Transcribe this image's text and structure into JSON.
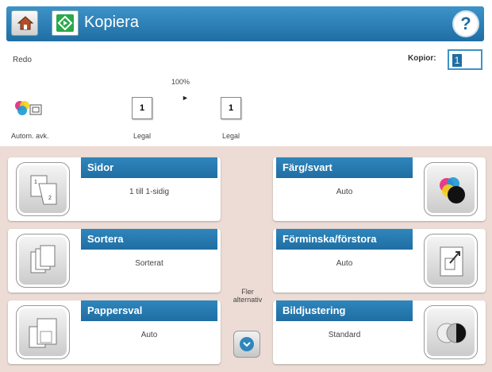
{
  "header": {
    "title": "Kopiera",
    "help": "?"
  },
  "status": {
    "ready_text": "Redo",
    "copies_label": "Kopior:",
    "copies_value": "1",
    "scale": "100%",
    "source_copies": "1",
    "source_paper": "Legal",
    "dest_copies": "1",
    "dest_paper": "Legal",
    "auto_label": "Autom. avk."
  },
  "tiles": {
    "sides": {
      "label": "Sidor",
      "value": "1 till 1-sidig"
    },
    "collate": {
      "label": "Sortera",
      "value": "Sorterat"
    },
    "paper": {
      "label": "Pappersval",
      "value": "Auto"
    },
    "color": {
      "label": "Färg/svart",
      "value": "Auto"
    },
    "reduce": {
      "label": "Förminska/förstora",
      "value": "Auto"
    },
    "image": {
      "label": "Bildjustering",
      "value": "Standard"
    }
  },
  "more": {
    "label": "Fler alternativ"
  },
  "colors": {
    "accent": "#1f6ea3",
    "panel_bg": "#ecdcd5",
    "start_green": "#2aa84a"
  }
}
